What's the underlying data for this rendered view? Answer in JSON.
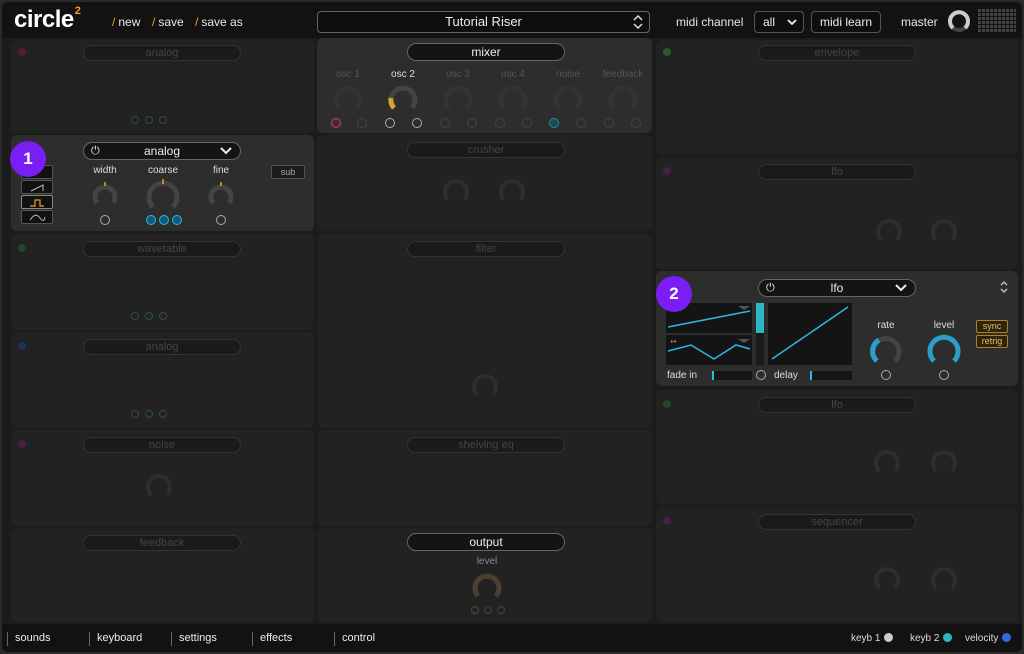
{
  "app": {
    "logo_text": "circle",
    "logo_super": "2",
    "menu": [
      {
        "label": "new"
      },
      {
        "label": "save"
      },
      {
        "label": "save as"
      }
    ],
    "preset_name": "Tutorial Riser",
    "midi_channel_label": "midi channel",
    "midi_channel_value": "all",
    "midi_learn_label": "midi learn",
    "master_label": "master"
  },
  "mixer": {
    "title": "mixer",
    "channels": [
      "osc 1",
      "osc 2",
      "osc 3",
      "osc 4",
      "noise",
      "feedback"
    ],
    "active_channel": "osc 2"
  },
  "analog_panel": {
    "badge": "1",
    "title": "analog",
    "knobs": [
      "width",
      "coarse",
      "fine"
    ],
    "sub_label": "sub"
  },
  "lfo_panel": {
    "badge": "2",
    "title": "lfo",
    "fade_in_label": "fade in",
    "delay_label": "delay",
    "rate_label": "rate",
    "level_label": "level",
    "sync_label": "sync",
    "retrig_label": "retrig"
  },
  "background_modules": {
    "left": [
      "analog",
      "wavetable",
      "analog",
      "noise",
      "feedback"
    ],
    "middle": [
      "crusher",
      "filter",
      "shelving eq"
    ],
    "right": [
      "envelope",
      "lfo",
      "lfo",
      "sequencer"
    ]
  },
  "output": {
    "title": "output",
    "level_label": "level"
  },
  "bottom_tabs": [
    "sounds",
    "keyboard",
    "settings",
    "effects",
    "control"
  ],
  "key_indicators": [
    {
      "label": "keyb 1",
      "color": "#cccccc"
    },
    {
      "label": "keyb 2",
      "color": "#2ab8c8"
    },
    {
      "label": "velocity",
      "color": "#2f6be0"
    }
  ],
  "colors": {
    "accent_orange": "#f0a020",
    "accent_cyan": "#2ab8e8",
    "badge_purple": "#7b1ef5"
  }
}
